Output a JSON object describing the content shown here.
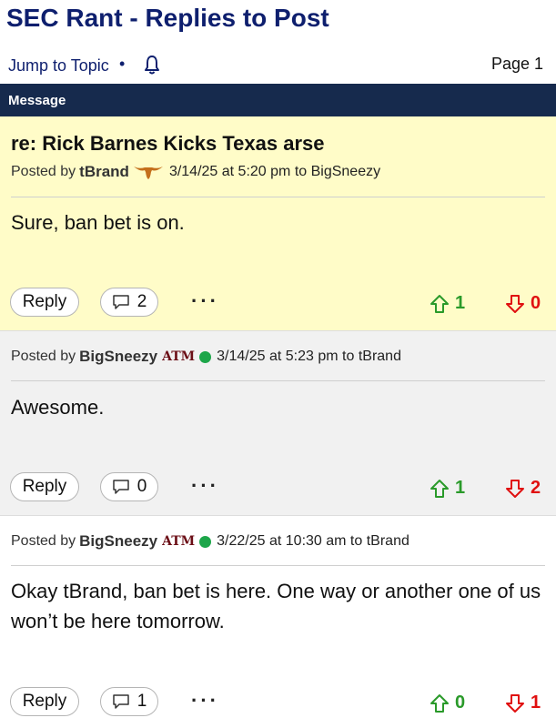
{
  "header": {
    "title": "SEC Rant - Replies to Post",
    "jump_label": "Jump to Topic",
    "bullet": "•",
    "page_label": "Page 1"
  },
  "message_bar": {
    "label": "Message"
  },
  "posts": [
    {
      "title": "re: Rick Barnes Kicks Texas arse",
      "posted_by": "Posted by",
      "user": "tBrand",
      "date_to": "3/14/25 at 5:20 pm to BigSneezy",
      "body": "Sure, ban bet is on.",
      "reply_label": "Reply",
      "comments": "2",
      "more": "···",
      "upvotes": "1",
      "downvotes": "0"
    },
    {
      "posted_by": "Posted by",
      "user": "BigSneezy",
      "badge": "ATM",
      "date_to": "3/14/25 at 5:23 pm to tBrand",
      "body": "Awesome.",
      "reply_label": "Reply",
      "comments": "0",
      "more": "···",
      "upvotes": "1",
      "downvotes": "2"
    },
    {
      "posted_by": "Posted by",
      "user": "BigSneezy",
      "badge": "ATM",
      "date_to": "3/22/25 at 10:30 am to tBrand",
      "body": "Okay tBrand, ban bet is here. One way or another one of us won’t be here tomorrow.",
      "reply_label": "Reply",
      "comments": "1",
      "more": "···",
      "upvotes": "0",
      "downvotes": "1"
    }
  ],
  "colors": {
    "title": "#0e1f6e",
    "message_bar": "#162a4d",
    "first_post_bg": "#fffcc8",
    "second_post_bg": "#f1f1f1",
    "upvote": "#2a9a2a",
    "downvote": "#e01010",
    "online": "#1da64a"
  }
}
